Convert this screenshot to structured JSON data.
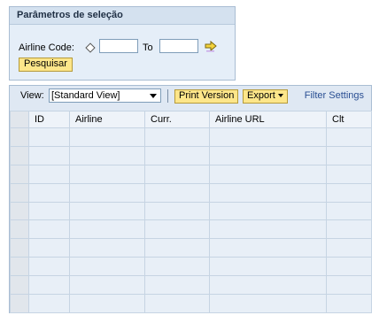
{
  "selection": {
    "title": "Parâmetros de seleção",
    "airline_code_label": "Airline Code:",
    "from_value": "",
    "to_label": "To",
    "to_value": "",
    "search_button": "Pesquisar"
  },
  "results": {
    "view_label": "View:",
    "view_selected": "[Standard View]",
    "print_button": "Print Version",
    "export_button": "Export",
    "filter_link": "Filter Settings",
    "columns": [
      "ID",
      "Airline",
      "Curr.",
      "Airline URL",
      "Clt"
    ],
    "rows": [
      [
        "",
        "",
        "",
        "",
        ""
      ],
      [
        "",
        "",
        "",
        "",
        ""
      ],
      [
        "",
        "",
        "",
        "",
        ""
      ],
      [
        "",
        "",
        "",
        "",
        ""
      ],
      [
        "",
        "",
        "",
        "",
        ""
      ],
      [
        "",
        "",
        "",
        "",
        ""
      ],
      [
        "",
        "",
        "",
        "",
        ""
      ],
      [
        "",
        "",
        "",
        "",
        ""
      ],
      [
        "",
        "",
        "",
        "",
        ""
      ],
      [
        "",
        "",
        "",
        "",
        ""
      ]
    ]
  },
  "colors": {
    "panel_bg": "#e5eef8",
    "button_bg": "#fde68a",
    "link": "#2a4f93"
  },
  "icons": [
    "diamond-icon",
    "arrow-right-icon",
    "dropdown-caret-icon"
  ]
}
